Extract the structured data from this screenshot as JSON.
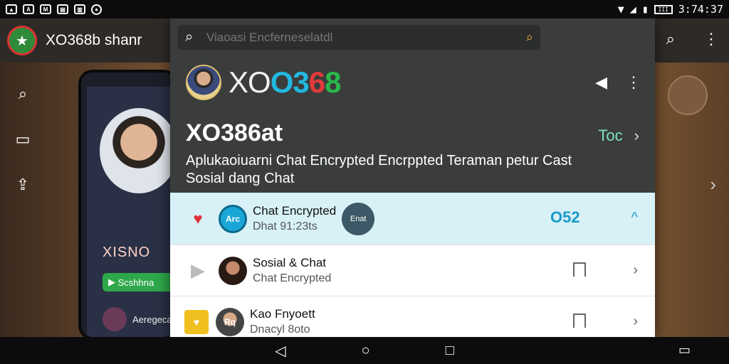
{
  "status_bar": {
    "left_icons": [
      "image-icon",
      "text-icon",
      "mail-icon",
      "calendar-icon",
      "video-icon",
      "record-icon"
    ],
    "time": "3:74:37",
    "battery_label": "III"
  },
  "background_app": {
    "title": "XO368b shanr",
    "phone_brand": "XISNO",
    "phone_button": "Scshhna",
    "phone_item": "Aeregeca"
  },
  "panel": {
    "search_placeholder": "Viaoasi Encferneselatdl",
    "brand": {
      "p1": "XO",
      "p2": "O",
      "p3": "3",
      "p4": "6",
      "p5": "8"
    },
    "heading": "XO386at",
    "tab_link": "Toc",
    "description": "Aplukaoiuarni Chat Encrypted Encrppted Teraman petur Cast Sosial dang Chat"
  },
  "list": [
    {
      "title": "Chat Encrypted",
      "subtitle": "Dhat 91:23ts",
      "avatar_text": "Arc",
      "bubble": "Enat",
      "badge": "O52"
    },
    {
      "title": "Sosial & Chat",
      "subtitle": "Chat Encrypted"
    },
    {
      "title": "Kao Fnyoett",
      "subtitle": "Dnacyl 8oto",
      "lead_text": "Rq"
    }
  ],
  "colors": {
    "accent": "#1a9ac8",
    "highlight_row": "#d7f1f7",
    "panel_bg": "#3a3d3c"
  }
}
